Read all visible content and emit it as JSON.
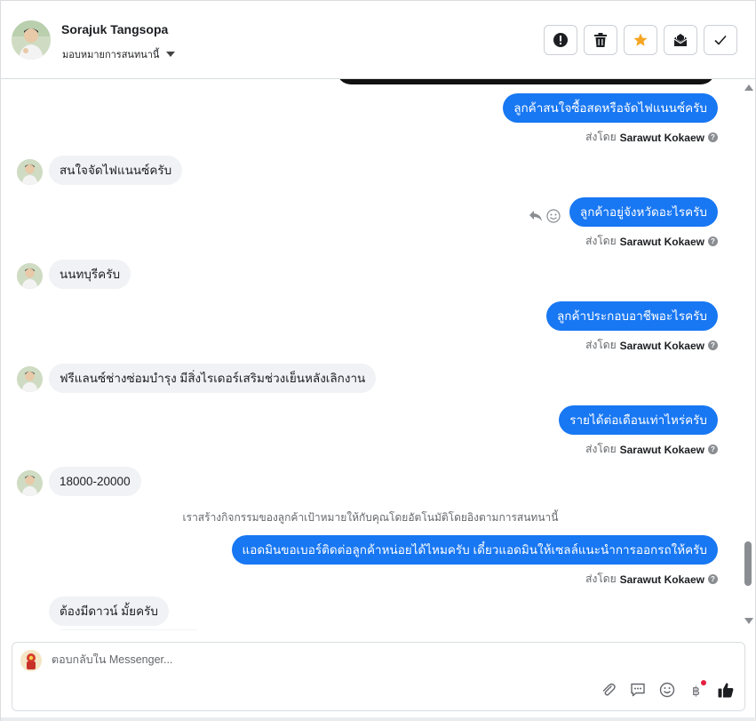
{
  "header": {
    "contact_name": "Sorajuk Tangsopa",
    "assign_label": "มอบหมายการสนทนานี้",
    "actions": [
      {
        "name": "spam-icon"
      },
      {
        "name": "trash-icon"
      },
      {
        "name": "star-icon"
      },
      {
        "name": "mark-unread-icon"
      },
      {
        "name": "check-icon"
      }
    ]
  },
  "messages": {
    "m1": "ลูกค้าสนใจซื้อสดหรือจัดไฟแนนซ์ครับ",
    "m2": "สนใจจัดไฟแนนซ์ครับ",
    "m3": "ลูกค้าอยู่จังหวัดอะไรครับ",
    "m4": "นนทบุรีครับ",
    "m5": "ลูกค้าประกอบอาชีพอะไรครับ",
    "m6": "ฟรีแลนซ์ช่างซ่อมบำรุง มีสิ่งไรเดอร์เสริมช่วงเย็นหลังเลิกงาน",
    "m7": "รายได้ต่อเดือนเท่าไหร่ครับ",
    "m8": "18000-20000",
    "m9": "แอดมินขอเบอร์ติดต่อลูกค้าหน่อยได้ไหมครับ เดี๋ยวแอดมินให้เซลล์แนะนำการออกรถให้ครับ",
    "m10": "ต้องมีดาวน์ มั้ยครับ"
  },
  "sent_by": {
    "prefix": "ส่งโดย",
    "agent": "Sarawut Kokaew"
  },
  "system_note": "เราสร้างกิจกรรมของลูกค้าเป้าหมายให้กับคุณโดยอัตโนมัติโดยอิงตามการสนทนานี้",
  "composer": {
    "placeholder": "ตอบกลับใน Messenger...",
    "tools": [
      "attach-icon",
      "saved-reply-icon",
      "emoji-icon",
      "payment-icon",
      "like-icon"
    ]
  },
  "colors": {
    "outgoing_bubble": "#1877f2",
    "incoming_bubble": "#f0f2f5",
    "star": "#f5a623"
  }
}
